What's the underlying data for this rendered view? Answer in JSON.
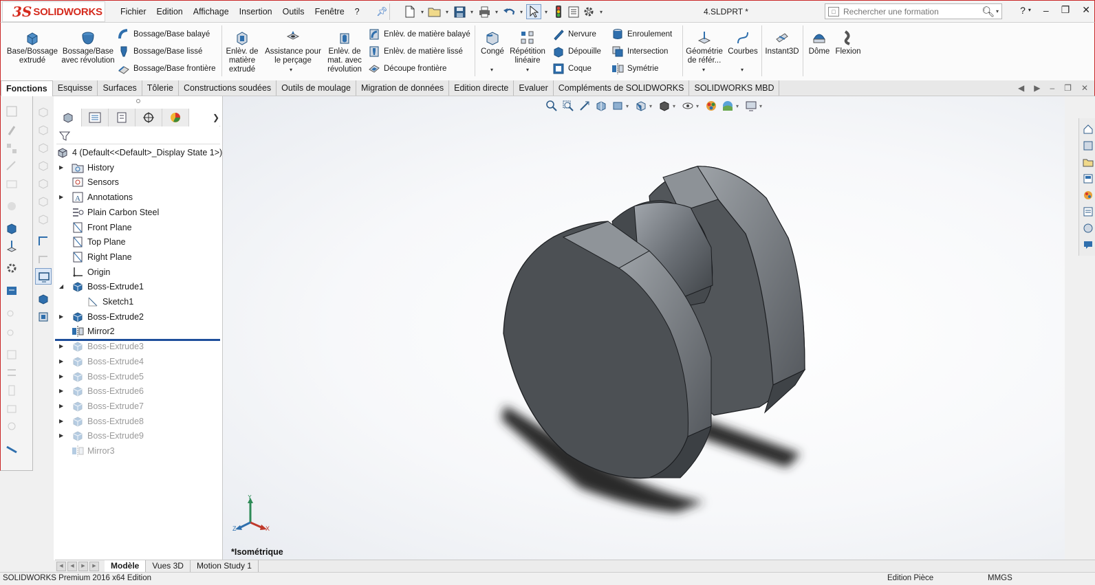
{
  "app": {
    "brand_mark": "3S",
    "brand": "SOLIDWORKS",
    "doc_title": "4.SLDPRT *"
  },
  "menu": [
    "Fichier",
    "Edition",
    "Affichage",
    "Insertion",
    "Outils",
    "Fenêtre",
    "?"
  ],
  "search": {
    "placeholder": "Rechercher une formation"
  },
  "ribbon": {
    "base_bossage": "Base/Bossage extrudé",
    "bossage_revolution": "Bossage/Base avec révolution",
    "bossage_balaye": "Bossage/Base balayé",
    "bossage_lisse": "Bossage/Base lissé",
    "bossage_frontiere": "Bossage/Base frontière",
    "enlev_extrude": "Enlèv. de matière extrudé",
    "assistance_percage": "Assistance pour le perçage",
    "enlev_revolution": "Enlèv. de mat. avec révolution",
    "enlev_balaye": "Enlèv. de matière balayé",
    "enlev_lisse": "Enlèv. de matière lissé",
    "decoupe_frontiere": "Découpe frontière",
    "conge": "Congé",
    "repetition": "Répétition linéaire",
    "nervure": "Nervure",
    "depouille": "Dépouille",
    "coque": "Coque",
    "enroulement": "Enroulement",
    "intersection": "Intersection",
    "symetrie": "Symétrie",
    "geometrie": "Géométrie de référ...",
    "courbes": "Courbes",
    "instant3d": "Instant3D",
    "dome": "Dôme",
    "flexion": "Flexion"
  },
  "tabs": [
    "Fonctions",
    "Esquisse",
    "Surfaces",
    "Tôlerie",
    "Constructions soudées",
    "Outils de moulage",
    "Migration de données",
    "Edition directe",
    "Evaluer",
    "Compléments de SOLIDWORKS",
    "SOLIDWORKS MBD"
  ],
  "tree": {
    "root": "4  (Default<<Default>_Display State 1>)",
    "items": [
      "History",
      "Sensors",
      "Annotations",
      "Plain Carbon Steel",
      "Front Plane",
      "Top Plane",
      "Right Plane",
      "Origin",
      "Boss-Extrude1",
      "Sketch1",
      "Boss-Extrude2",
      "Mirror2",
      "Boss-Extrude3",
      "Boss-Extrude4",
      "Boss-Extrude5",
      "Boss-Extrude6",
      "Boss-Extrude7",
      "Boss-Extrude8",
      "Boss-Extrude9",
      "Mirror3"
    ]
  },
  "viewport": {
    "view_name": "*Isométrique",
    "triad": {
      "x": "X",
      "y": "Y",
      "z": "Z"
    }
  },
  "bottom_tabs": [
    "Modèle",
    "Vues 3D",
    "Motion Study 1"
  ],
  "status": {
    "left": "SOLIDWORKS Premium 2016 x64 Edition",
    "mid": "Edition Pièce",
    "right": "MMGS"
  },
  "colors": {
    "accent_red": "#d52b1e",
    "brand_blue": "#1e6fa8",
    "part_gray": "#5d6165"
  }
}
